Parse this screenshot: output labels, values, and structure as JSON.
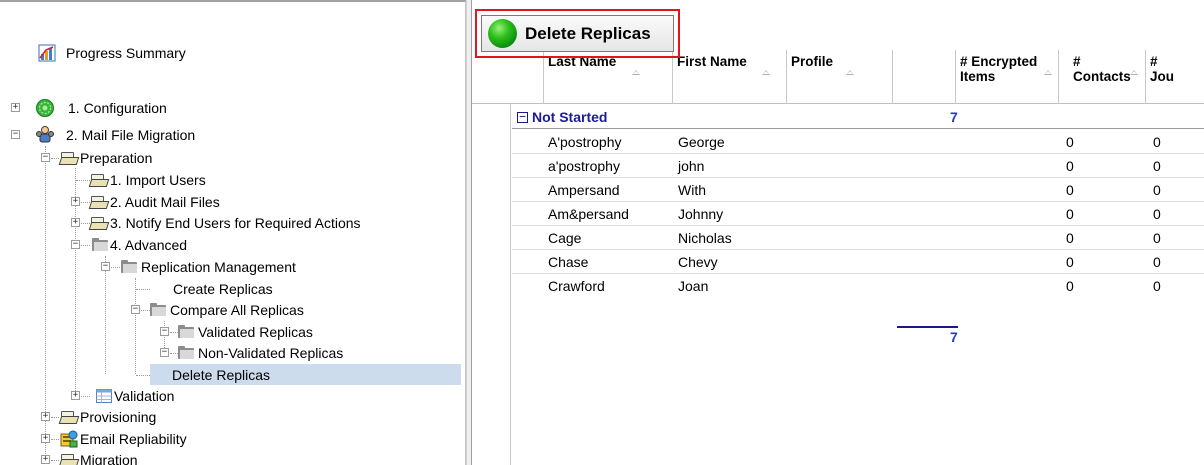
{
  "tree": {
    "progress_summary": "Progress Summary",
    "configuration": "1. Configuration",
    "mail_file_migration": "2. Mail File Migration",
    "preparation": "Preparation",
    "import_users": "1. Import Users",
    "audit_mail_files": "2. Audit Mail Files",
    "notify_end_users": "3. Notify End Users for Required Actions",
    "advanced": "4. Advanced",
    "replication_management": "Replication Management",
    "create_replicas": "Create Replicas",
    "compare_all_replicas": "Compare All Replicas",
    "validated_replicas": "Validated Replicas",
    "non_validated_replicas": "Non-Validated Replicas",
    "delete_replicas": "Delete Replicas",
    "validation": "Validation",
    "provisioning": "Provisioning",
    "email_repliability": "Email Repliability",
    "migration": "Migration"
  },
  "toolbar": {
    "delete_replicas_label": "Delete Replicas",
    "highlight_color": "#e3141e"
  },
  "grid": {
    "columns": {
      "last_name": "Last Name",
      "first_name": "First Name",
      "profile": "Profile",
      "encrypted_items_line1": "# Encrypted",
      "encrypted_items_line2": "Items",
      "contacts_line1": "#",
      "contacts_line2": "Contacts",
      "journal_line1": "#",
      "journal_line2": "Jou"
    },
    "group": {
      "toggle": "−",
      "title": "Not Started",
      "count": "7"
    },
    "rows": [
      {
        "last_name": "A'postrophy",
        "first_name": "George",
        "profile": "",
        "encrypted": "",
        "contacts": "0",
        "journal": "0"
      },
      {
        "last_name": "a'postrophy",
        "first_name": "john",
        "profile": "",
        "encrypted": "",
        "contacts": "0",
        "journal": "0"
      },
      {
        "last_name": "Ampersand",
        "first_name": "With",
        "profile": "",
        "encrypted": "",
        "contacts": "0",
        "journal": "0"
      },
      {
        "last_name": "Am&persand",
        "first_name": "Johnny",
        "profile": "",
        "encrypted": "",
        "contacts": "0",
        "journal": "0"
      },
      {
        "last_name": "Cage",
        "first_name": "Nicholas",
        "profile": "",
        "encrypted": "",
        "contacts": "0",
        "journal": "0"
      },
      {
        "last_name": "Chase",
        "first_name": "Chevy",
        "profile": "",
        "encrypted": "",
        "contacts": "0",
        "journal": "0"
      },
      {
        "last_name": "Crawford",
        "first_name": "Joan",
        "profile": "",
        "encrypted": "",
        "contacts": "0",
        "journal": "0"
      }
    ],
    "footer_count": "7"
  }
}
